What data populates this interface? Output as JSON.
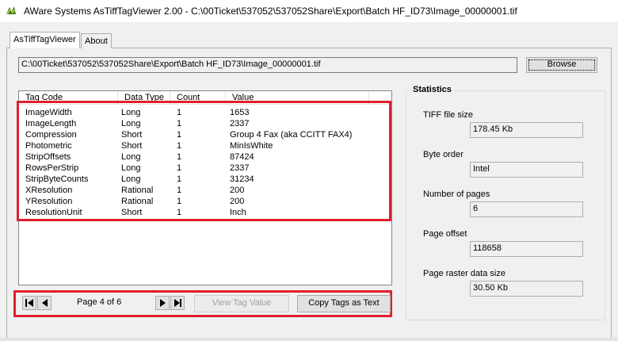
{
  "window": {
    "title": "AWare Systems  AsTiffTagViewer  2.00  -  C:\\00Ticket\\537052\\537052Share\\Export\\Batch HF_ID73\\Image_00000001.tif"
  },
  "tabs": [
    {
      "label": "AsTiffTagViewer",
      "selected": true
    },
    {
      "label": "About",
      "selected": false
    }
  ],
  "path": {
    "value": "C:\\00Ticket\\537052\\537052Share\\Export\\Batch HF_ID73\\Image_00000001.tif",
    "browse_label": "Browse"
  },
  "tag_table": {
    "columns": [
      "Tag Code",
      "Data Type",
      "Count",
      "Value"
    ],
    "rows": [
      [
        "ImageWidth",
        "Long",
        "1",
        "1653"
      ],
      [
        "ImageLength",
        "Long",
        "1",
        "2337"
      ],
      [
        "Compression",
        "Short",
        "1",
        "Group 4 Fax (aka CCITT FAX4)"
      ],
      [
        "Photometric",
        "Short",
        "1",
        "MinIsWhite"
      ],
      [
        "StripOffsets",
        "Long",
        "1",
        "87424"
      ],
      [
        "RowsPerStrip",
        "Long",
        "1",
        "2337"
      ],
      [
        "StripByteCounts",
        "Long",
        "1",
        "31234"
      ],
      [
        "XResolution",
        "Rational",
        "1",
        "200"
      ],
      [
        "YResolution",
        "Rational",
        "1",
        "200"
      ],
      [
        "ResolutionUnit",
        "Short",
        "1",
        "Inch"
      ]
    ]
  },
  "navigation": {
    "page_label": "Page 4 of 6",
    "view_tag_label": "View Tag Value",
    "copy_tags_label": "Copy Tags as Text"
  },
  "statistics": {
    "title": "Statistics",
    "tiff_file_size_label": "TIFF file size",
    "tiff_file_size": "178.45 Kb",
    "byte_order_label": "Byte order",
    "byte_order": "Intel",
    "num_pages_label": "Number of pages",
    "num_pages": "6",
    "page_offset_label": "Page offset",
    "page_offset": "118658",
    "page_raster_label": "Page raster data size",
    "page_raster": "30.50 Kb"
  },
  "colors": {
    "highlight": "#e0202c",
    "window_bg": "#f0f0f0"
  }
}
